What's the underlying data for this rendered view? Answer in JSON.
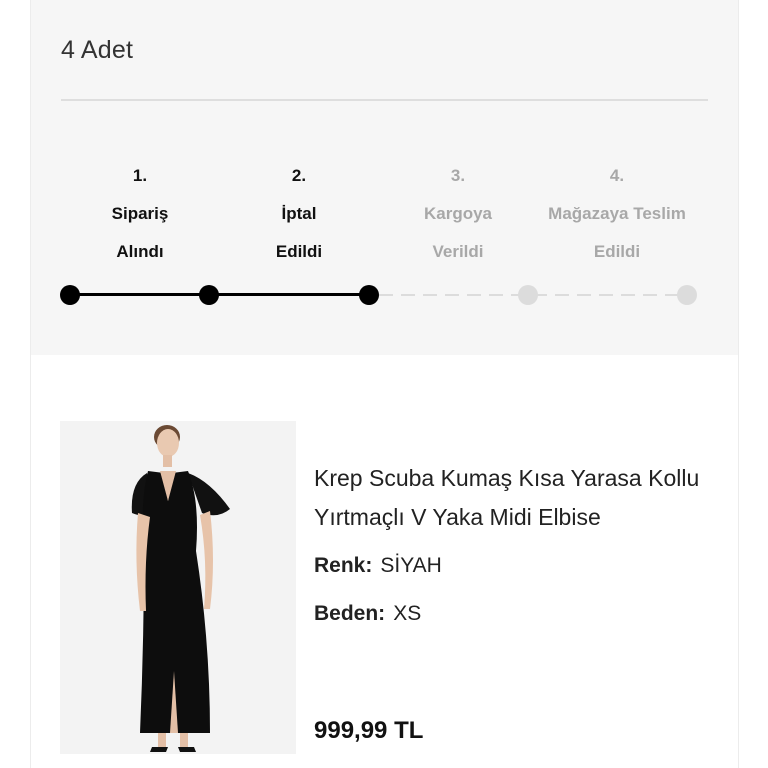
{
  "order": {
    "quantity_text": "4 Adet"
  },
  "steps": [
    {
      "num": "1.",
      "line1": "Sipariş",
      "line2": "Alındı",
      "active": true
    },
    {
      "num": "2.",
      "line1": "İptal",
      "line2": "Edildi",
      "active": true
    },
    {
      "num": "3.",
      "line1": "Kargoya",
      "line2": "Verildi",
      "active": false
    },
    {
      "num": "4.",
      "line1": "Mağazaya Teslim",
      "line2": "Edildi",
      "active": false
    }
  ],
  "product": {
    "title": "Krep Scuba Kumaş Kısa Yarasa Kollu Yırtmaçlı V Yaka Midi Elbise",
    "color_label": "Renk:",
    "color_value": "SİYAH",
    "size_label": "Beden:",
    "size_value": "XS",
    "price": "999,99 TL",
    "image_icon": "dress-photo"
  },
  "colors": {
    "active": "#000000",
    "inactive": "#dcdcdc",
    "inactive_text": "#a8a8a8"
  }
}
